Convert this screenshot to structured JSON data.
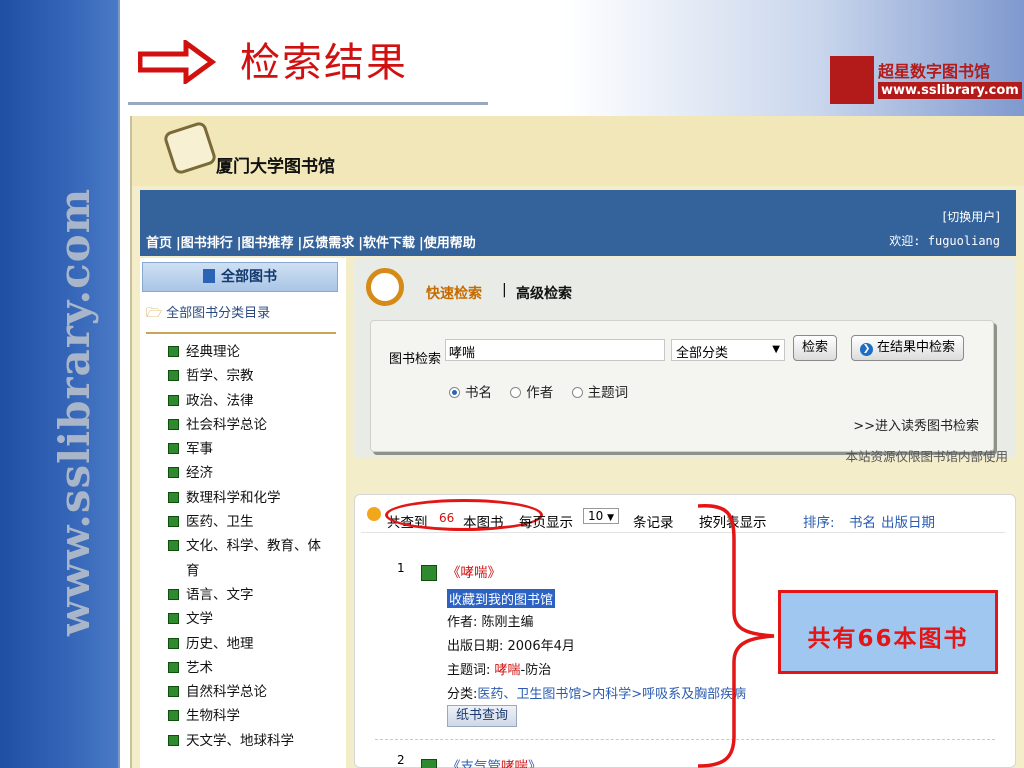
{
  "watermark": "www.sslibrary.com",
  "slide": {
    "title": "检索结果"
  },
  "logo": {
    "name": "超星数字图书馆",
    "url": "www.sslibrary.com"
  },
  "colors": {
    "title_red": "#d11010",
    "nav_blue": "#33639a",
    "annotation_red": "#e31515",
    "callout_fill": "#9fc7ef"
  },
  "site": {
    "library_name": "厦门大学图书馆",
    "nav": [
      "首页",
      "|图书排行",
      "|图书推荐",
      "|反馈需求",
      "|软件下载",
      "|使用帮助"
    ],
    "switch_user": "[切换用户]",
    "welcome": "欢迎: fuguoliang"
  },
  "sidebar": {
    "tab_label": "全部图书",
    "root_label": "全部图书分类目录",
    "categories": [
      "经典理论",
      "哲学、宗教",
      "政治、法律",
      "社会科学总论",
      "军事",
      "经济",
      "数理科学和化学",
      "医药、卫生",
      "文化、科学、教育、体",
      "育",
      "语言、文字",
      "文学",
      "历史、地理",
      "艺术",
      "自然科学总论",
      "生物科学",
      "天文学、地球科学"
    ]
  },
  "search": {
    "quick_label": "快速检索",
    "separator": "|",
    "advanced_label": "高级检索",
    "field_label": "图书检索",
    "query": "哮喘",
    "category_select": "全部分类",
    "search_button": "检索",
    "search_in_results_button": "在结果中检索",
    "radio_options": [
      "书名",
      "作者",
      "主题词"
    ],
    "selected_option": "书名",
    "enter_link": ">>进入读秀图书检索",
    "notice": "本站资源仅限图书馆内部使用"
  },
  "results": {
    "found_prefix": "共查到",
    "count": "66",
    "found_suffix": "本图书",
    "per_page_label": "每页显示",
    "per_page_value": "10",
    "records_label": "条记录",
    "list_view": "按列表显示",
    "sort_label": "排序:",
    "sort_title": "书名",
    "sort_date": "出版日期",
    "items": [
      {
        "no": "1",
        "title": "《哮喘》",
        "collect": "收藏到我的图书馆",
        "author": "作者: 陈刚主编",
        "pub_date": "出版日期: 2006年4月",
        "subject_prefix": "主题词: ",
        "subject_hl": "哮喘",
        "subject_suffix": "-防治",
        "category_prefix": "分类:",
        "category_path": "医药、卫生图书馆>内科学>呼吸系及胸部疾病",
        "paper_button": "纸书查询"
      },
      {
        "no": "2",
        "title_prefix": "《支气管",
        "title_hl": "哮喘",
        "title_suffix": "》"
      }
    ]
  },
  "annotation": {
    "text_prefix": "共有",
    "count": "66",
    "text_suffix": "本图书"
  }
}
